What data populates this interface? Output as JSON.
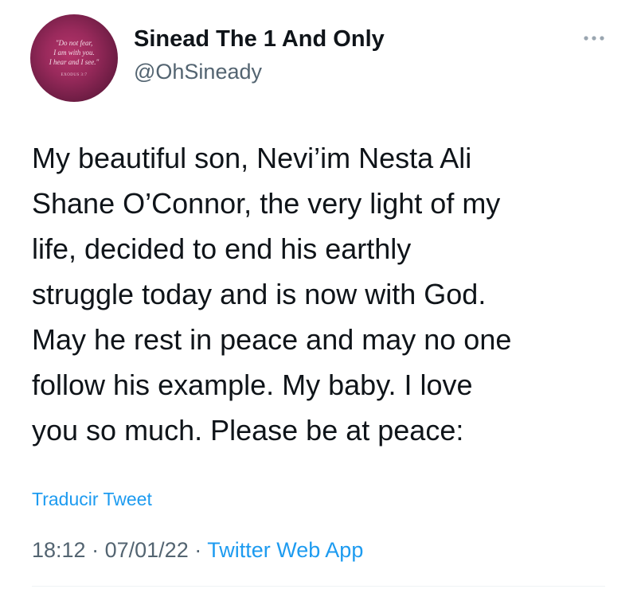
{
  "tweet": {
    "author": {
      "display_name": "Sinead The 1 And Only",
      "handle": "@OhSineady",
      "avatar": {
        "quote_lines": [
          "\"Do not fear,",
          "I am with you.",
          "I hear and I see.\""
        ],
        "reference": "EXODUS 3:7"
      }
    },
    "more_icon": "ellipsis-icon",
    "text": "My beautiful son, Nevi’im Nesta Ali\nShane O’Connor, the very light of my\nlife, decided to end his earthly\nstruggle today and is now with God.\nMay he rest in peace and may no one\nfollow his example.  My baby. I love\nyou so much. Please be at peace:",
    "translate_label": "Traducir Tweet",
    "time": "18:12",
    "separator": "·",
    "date": "07/01/22",
    "source": "Twitter Web App"
  },
  "colors": {
    "text_primary": "#0f1419",
    "text_secondary": "#536471",
    "accent": "#1d9bf0",
    "avatar_bg": "#9a2a5c"
  }
}
